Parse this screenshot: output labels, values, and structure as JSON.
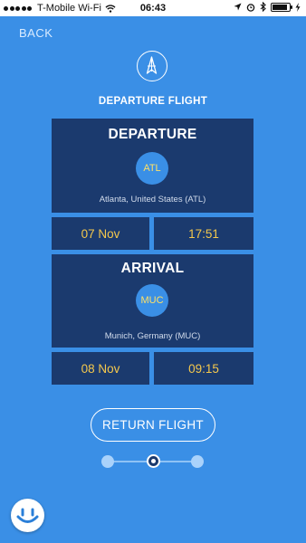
{
  "status_bar": {
    "carrier": "T-Mobile Wi-Fi",
    "time": "06:43",
    "battery_level": 0.9
  },
  "nav": {
    "back_label": "BACK"
  },
  "header": {
    "logo_icon": "plane-logo-icon",
    "title": "DEPARTURE FLIGHT"
  },
  "departure": {
    "heading": "DEPARTURE",
    "code": "ATL",
    "city": "Atlanta, United States (ATL)",
    "date": "07 Nov",
    "time": "17:51"
  },
  "arrival": {
    "heading": "ARRIVAL",
    "code": "MUC",
    "city": "Munich, Germany (MUC)",
    "date": "08 Nov",
    "time": "09:15"
  },
  "actions": {
    "return_label": "RETURN FLIGHT"
  },
  "pager": {
    "pages": 3,
    "active_index": 1
  },
  "colors": {
    "background": "#3a8fe6",
    "panel": "#1b3a6e",
    "highlight_text": "#f5c84c"
  }
}
